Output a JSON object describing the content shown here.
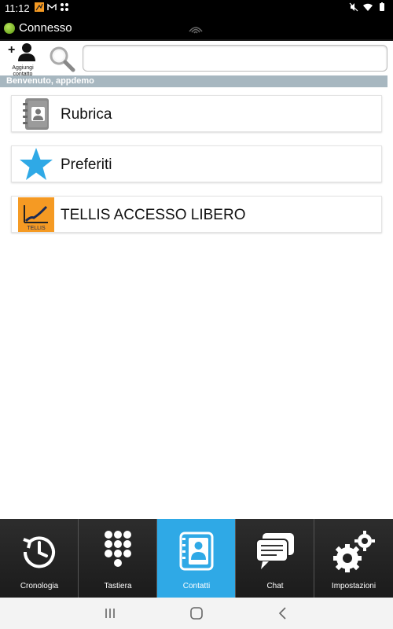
{
  "status_bar": {
    "time": "11:12"
  },
  "title_bar": {
    "status": "Connesso"
  },
  "toolbar": {
    "add_contact_line1": "Aggiungi",
    "add_contact_line2": "contatto",
    "search_placeholder": "",
    "search_value": ""
  },
  "welcome": "Benvenuto, appdemo",
  "list": {
    "items": [
      {
        "label": "Rubrica",
        "icon": "address-book-icon"
      },
      {
        "label": "Preferiti",
        "icon": "star-icon"
      },
      {
        "label": "TELLIS ACCESSO LIBERO",
        "icon": "tellis-logo-icon",
        "logo_text": "TELLIS"
      }
    ]
  },
  "tabs": [
    {
      "label": "Cronologia",
      "icon": "history-clock-icon",
      "active": false
    },
    {
      "label": "Tastiera",
      "icon": "dialpad-icon",
      "active": false
    },
    {
      "label": "Contatti",
      "icon": "contacts-icon",
      "active": true
    },
    {
      "label": "Chat",
      "icon": "chat-bubbles-icon",
      "active": false
    },
    {
      "label": "Impostazioni",
      "icon": "gears-icon",
      "active": false
    }
  ],
  "colors": {
    "active_tab": "#2fa9e6",
    "welcome_bar": "#a7b7c0",
    "star": "#2fa9e6",
    "tellis_orange": "#f59a23"
  }
}
